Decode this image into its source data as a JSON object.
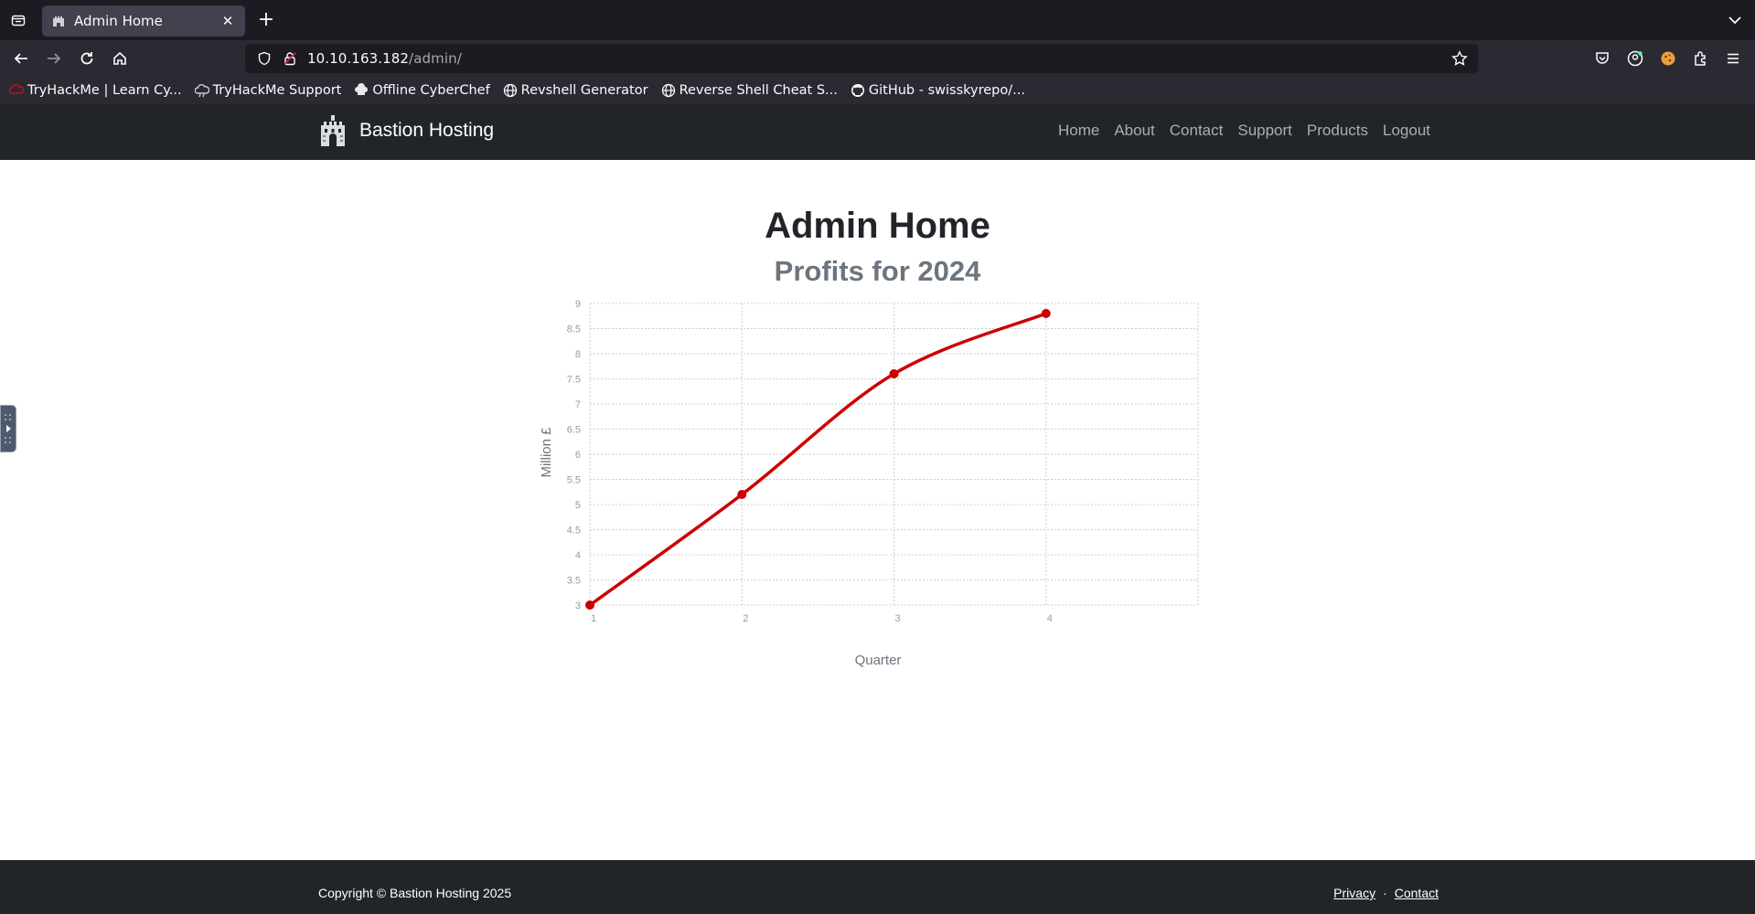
{
  "browser": {
    "tab": {
      "title": "Admin Home"
    },
    "url": {
      "host": "10.10.163.182",
      "path": "/admin/"
    },
    "bookmarks": [
      {
        "label": "TryHackMe | Learn Cy...",
        "icon": "tryhackme-icon"
      },
      {
        "label": "TryHackMe Support",
        "icon": "cloud-icon"
      },
      {
        "label": "Offline CyberChef",
        "icon": "chef-hat-icon"
      },
      {
        "label": "Revshell Generator",
        "icon": "globe-icon"
      },
      {
        "label": "Reverse Shell Cheat S...",
        "icon": "globe-icon"
      },
      {
        "label": "GitHub - swisskyrepo/...",
        "icon": "github-icon"
      }
    ]
  },
  "site": {
    "brand": "Bastion Hosting",
    "nav": [
      "Home",
      "About",
      "Contact",
      "Support",
      "Products",
      "Logout"
    ]
  },
  "page": {
    "title": "Admin Home",
    "subtitle": "Profits for 2024"
  },
  "chart_data": {
    "type": "line",
    "title": "",
    "xlabel": "Quarter",
    "ylabel": "Million £",
    "x": [
      1,
      2,
      3,
      4
    ],
    "series": [
      {
        "values": [
          3.0,
          5.2,
          7.6,
          8.8
        ],
        "color": "#cc0000"
      }
    ],
    "xticks": [
      "1",
      "2",
      "3",
      "4"
    ],
    "yticks": [
      "3",
      "3.5",
      "4",
      "4.5",
      "5",
      "5.5",
      "6",
      "6.5",
      "7",
      "7.5",
      "8",
      "8.5",
      "9"
    ],
    "xlim": [
      1,
      5
    ],
    "ylim": [
      3,
      9
    ],
    "grid": true,
    "legend": "none"
  },
  "footer": {
    "copyright": "Copyright © Bastion Hosting 2025",
    "links": [
      "Privacy",
      "Contact"
    ],
    "separator": "·"
  }
}
